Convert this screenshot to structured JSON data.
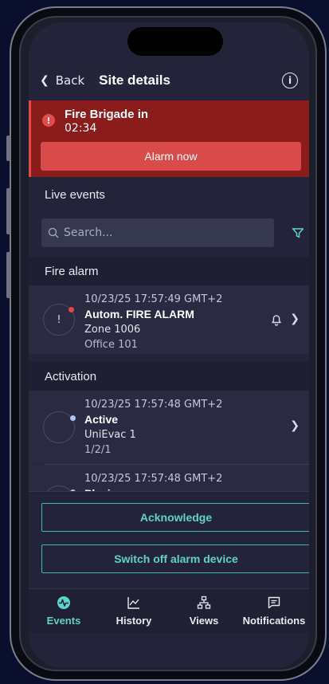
{
  "header": {
    "back_label": "Back",
    "title": "Site details"
  },
  "banner": {
    "title": "Fire Brigade in",
    "countdown": "02:34",
    "alarm_button": "Alarm now"
  },
  "live_events": {
    "label": "Live events",
    "search_placeholder": "Search..."
  },
  "groups": [
    {
      "title": "Fire alarm",
      "events": [
        {
          "timestamp": "10/23/25 17:57:49 GMT+2",
          "name": "Autom. FIRE ALARM",
          "line2": "Zone 1006",
          "line3": "Office 101",
          "status_glyph": "!",
          "dot_color": "#e0473f"
        }
      ]
    },
    {
      "title": "Activation",
      "events": [
        {
          "timestamp": "10/23/25 17:57:48 GMT+2",
          "name": "Active",
          "line2": "UniEvac 1",
          "line3": "1/2/1",
          "dot_color": "#a9c8f0"
        },
        {
          "timestamp": "10/23/25 17:57:48 GMT+2",
          "name": "Playing",
          "dot_color": "#a9c8f0"
        }
      ]
    }
  ],
  "actions": {
    "acknowledge": "Acknowledge",
    "switch_off": "Switch off alarm device"
  },
  "tabs": [
    {
      "label": "Events",
      "icon": "pulse-icon"
    },
    {
      "label": "History",
      "icon": "line-chart-icon"
    },
    {
      "label": "Views",
      "icon": "network-icon"
    },
    {
      "label": "Notifications",
      "icon": "message-icon"
    }
  ],
  "colors": {
    "accent": "#5fd3c9",
    "alarm_red": "#d94a4a",
    "banner_bg": "#8b1c1c",
    "background": "#23243a"
  }
}
